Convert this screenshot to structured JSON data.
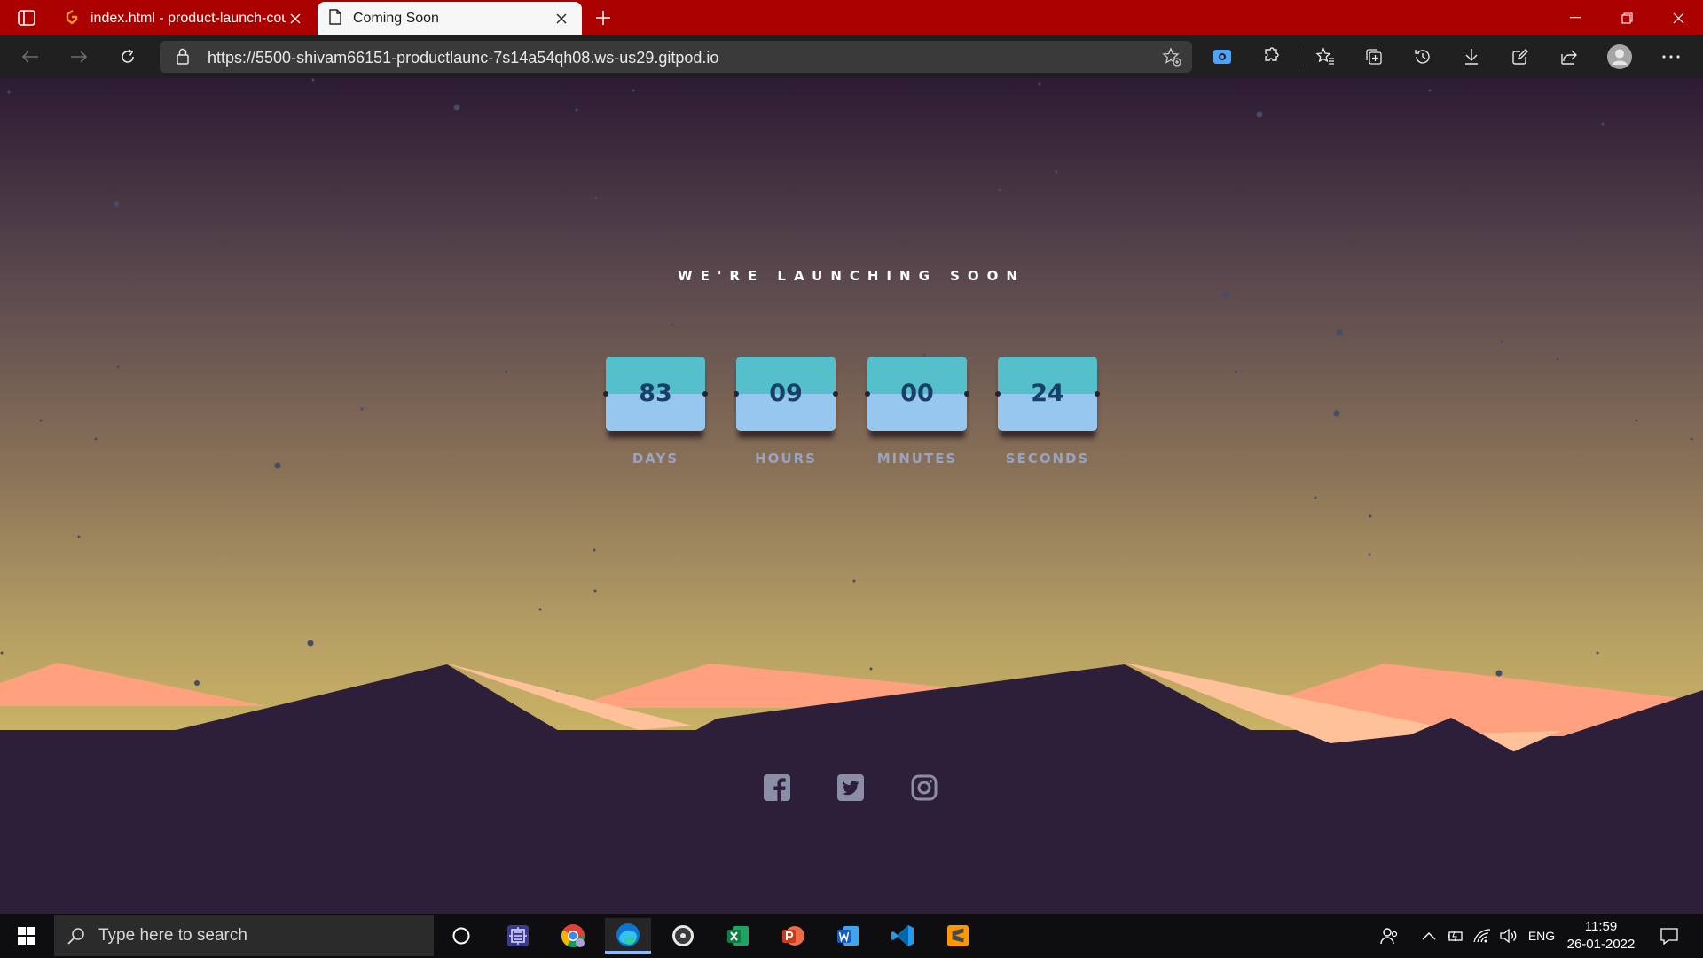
{
  "browser": {
    "tabs": [
      {
        "title": "index.html - product-launch-cou",
        "icon": "gitpod-icon",
        "active": false
      },
      {
        "title": "Coming Soon",
        "icon": "page-icon",
        "active": true
      }
    ],
    "url": "https://5500-shivam66151-productlaunc-7s14a54qh08.ws-us29.gitpod.io"
  },
  "page": {
    "headline": "WE'RE LAUNCHING SOON",
    "countdown": [
      {
        "value": "83",
        "label": "DAYS"
      },
      {
        "value": "09",
        "label": "HOURS"
      },
      {
        "value": "00",
        "label": "MINUTES"
      },
      {
        "value": "24",
        "label": "SECONDS"
      }
    ],
    "socials": [
      "facebook-icon",
      "twitter-icon",
      "instagram-icon"
    ]
  },
  "taskbar": {
    "search_placeholder": "Type here to search",
    "language": "ENG",
    "time": "11:59",
    "date": "26-01-2022"
  },
  "colors": {
    "tab_bar": "#aa0000",
    "card_top": "#55bfcc",
    "card_bottom": "#96c8ef",
    "digits": "#1b3e68",
    "labels": "#9aa3c2",
    "mountain_dark": "#2d1f3a",
    "mountain_light": "#ffc19a"
  }
}
